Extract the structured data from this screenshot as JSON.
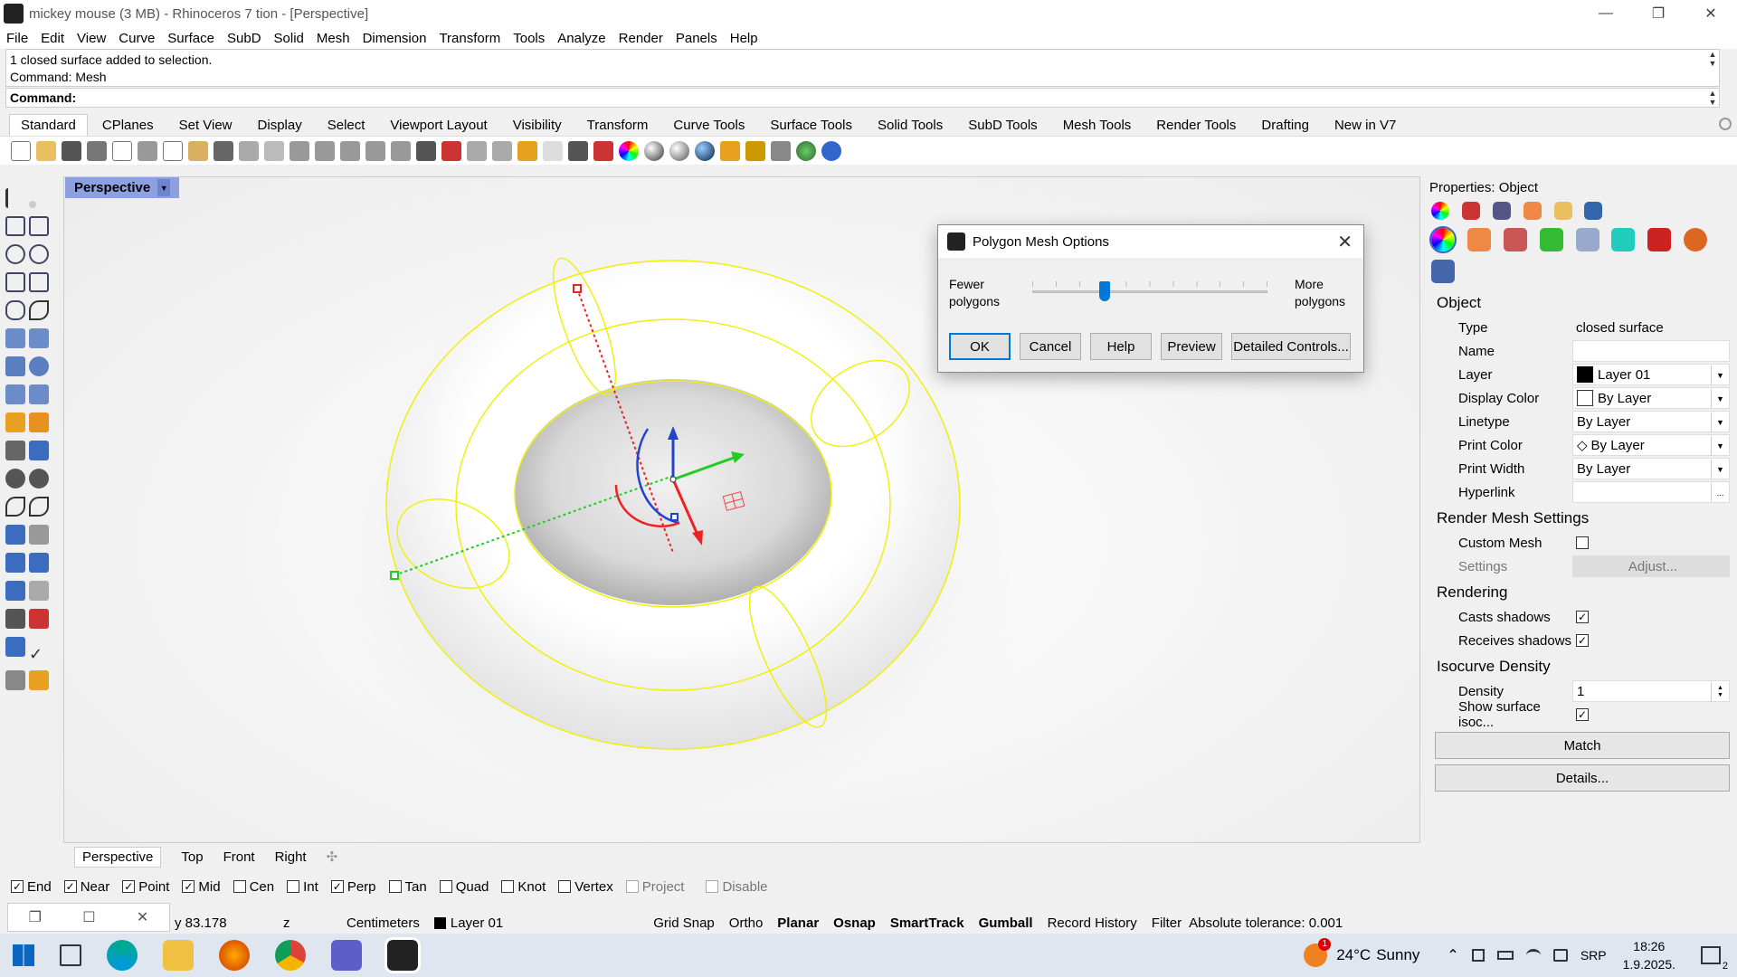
{
  "window": {
    "title": "mickey mouse (3 MB) - Rhinoceros 7 tion - [Perspective]",
    "min": "—",
    "max": "❐",
    "close": "✕"
  },
  "menu": [
    "File",
    "Edit",
    "View",
    "Curve",
    "Surface",
    "SubD",
    "Solid",
    "Mesh",
    "Dimension",
    "Transform",
    "Tools",
    "Analyze",
    "Render",
    "Panels",
    "Help"
  ],
  "command": {
    "history1": "1 closed surface added to selection.",
    "history2": "Command: Mesh",
    "prompt": "Command:"
  },
  "toolbar_tabs": [
    "Standard",
    "CPlanes",
    "Set View",
    "Display",
    "Select",
    "Viewport Layout",
    "Visibility",
    "Transform",
    "Curve Tools",
    "Surface Tools",
    "Solid Tools",
    "SubD Tools",
    "Mesh Tools",
    "Render Tools",
    "Drafting",
    "New in V7"
  ],
  "viewport": {
    "label": "Perspective",
    "tabs": [
      "Perspective",
      "Top",
      "Front",
      "Right"
    ],
    "add": "✣"
  },
  "dialog": {
    "title": "Polygon Mesh Options",
    "close": "✕",
    "fewer": "Fewer polygons",
    "more": "More polygons",
    "slider_value": 0.3,
    "buttons": {
      "ok": "OK",
      "cancel": "Cancel",
      "help": "Help",
      "preview": "Preview",
      "detailed": "Detailed Controls..."
    }
  },
  "properties": {
    "header": "Properties: Object",
    "object_section": "Object",
    "rows": {
      "type_k": "Type",
      "type_v": "closed surface",
      "name_k": "Name",
      "name_v": "",
      "layer_k": "Layer",
      "layer_v": "Layer 01",
      "dispcolor_k": "Display Color",
      "dispcolor_v": "By Layer",
      "linetype_k": "Linetype",
      "linetype_v": "By Layer",
      "printcolor_k": "Print Color",
      "printcolor_v": "By Layer",
      "printwidth_k": "Print Width",
      "printwidth_v": "By Layer",
      "hyperlink_k": "Hyperlink",
      "hyperlink_btn": "..."
    },
    "render_mesh_section": "Render Mesh Settings",
    "custom_mesh": "Custom Mesh",
    "settings_k": "Settings",
    "adjust": "Adjust...",
    "rendering_section": "Rendering",
    "casts": "Casts shadows",
    "receives": "Receives shadows",
    "iso_section": "Isocurve Density",
    "density_k": "Density",
    "density_v": "1",
    "show_iso": "Show surface isoc...",
    "match": "Match",
    "details": "Details..."
  },
  "osnap": {
    "items": [
      {
        "label": "End",
        "checked": true
      },
      {
        "label": "Near",
        "checked": true
      },
      {
        "label": "Point",
        "checked": true
      },
      {
        "label": "Mid",
        "checked": true
      },
      {
        "label": "Cen",
        "checked": false
      },
      {
        "label": "Int",
        "checked": false
      },
      {
        "label": "Perp",
        "checked": true
      },
      {
        "label": "Tan",
        "checked": false
      },
      {
        "label": "Quad",
        "checked": false
      },
      {
        "label": "Knot",
        "checked": false
      },
      {
        "label": "Vertex",
        "checked": false
      }
    ],
    "project": "Project",
    "disable": "Disable"
  },
  "status": {
    "y": "y 83.178",
    "z": "z",
    "units": "Centimeters",
    "layer": "Layer 01",
    "grid": "Grid Snap",
    "ortho": "Ortho",
    "planar": "Planar",
    "osnap": "Osnap",
    "smarttrack": "SmartTrack",
    "gumball": "Gumball",
    "history": "Record History",
    "filter": "Filter",
    "tolerance": "Absolute tolerance: 0.001"
  },
  "mini_window": {
    "restore": "❐",
    "max": "☐",
    "close": "✕"
  },
  "tray": {
    "weather_temp": "24°C",
    "weather": "Sunny",
    "badge": "1",
    "lang": "SRP",
    "time": "18:26",
    "date": "1.9.2025.",
    "notif": "2",
    "up": "⌃"
  },
  "colors": {
    "accent": "#0078d7",
    "viewport_label": "#8da0e0",
    "isocurve": "#f0f000"
  }
}
